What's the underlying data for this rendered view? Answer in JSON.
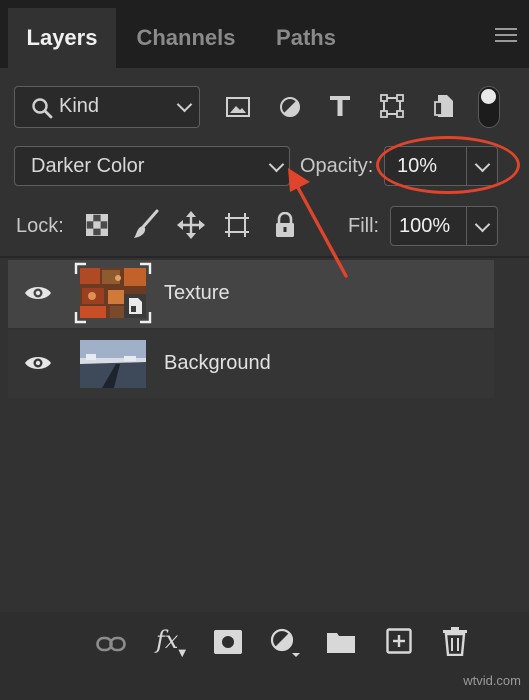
{
  "tabs": [
    {
      "label": "Layers",
      "active": true
    },
    {
      "label": "Channels",
      "active": false
    },
    {
      "label": "Paths",
      "active": false
    }
  ],
  "filter": {
    "kind_label": "Kind",
    "filter_icons": [
      "image-filter-icon",
      "adjustment-filter-icon",
      "type-filter-icon",
      "shape-filter-icon",
      "smart-object-filter-icon",
      "filter-toggle-icon"
    ]
  },
  "blend": {
    "mode": "Darker Color",
    "opacity_label": "Opacity:",
    "opacity_value": "10%"
  },
  "lock": {
    "label": "Lock:",
    "fill_label": "Fill:",
    "fill_value": "100%",
    "lock_icons": [
      "lock-transparent-icon",
      "lock-paint-icon",
      "lock-position-icon",
      "lock-artboard-icon",
      "lock-all-icon"
    ]
  },
  "layers": [
    {
      "name": "Texture",
      "selected": true,
      "visible": true,
      "smart_object": true
    },
    {
      "name": "Background",
      "selected": false,
      "visible": true,
      "smart_object": false
    }
  ],
  "bottom_icons": [
    "link-icon",
    "fx-icon",
    "mask-icon",
    "adjustment-layer-icon",
    "group-folder-icon",
    "new-layer-icon",
    "trash-icon"
  ],
  "annotation": {
    "color": "#e0442a"
  },
  "watermark": "wtvid.com",
  "colors": {
    "accent": "#e0442a",
    "panel": "#323232"
  }
}
